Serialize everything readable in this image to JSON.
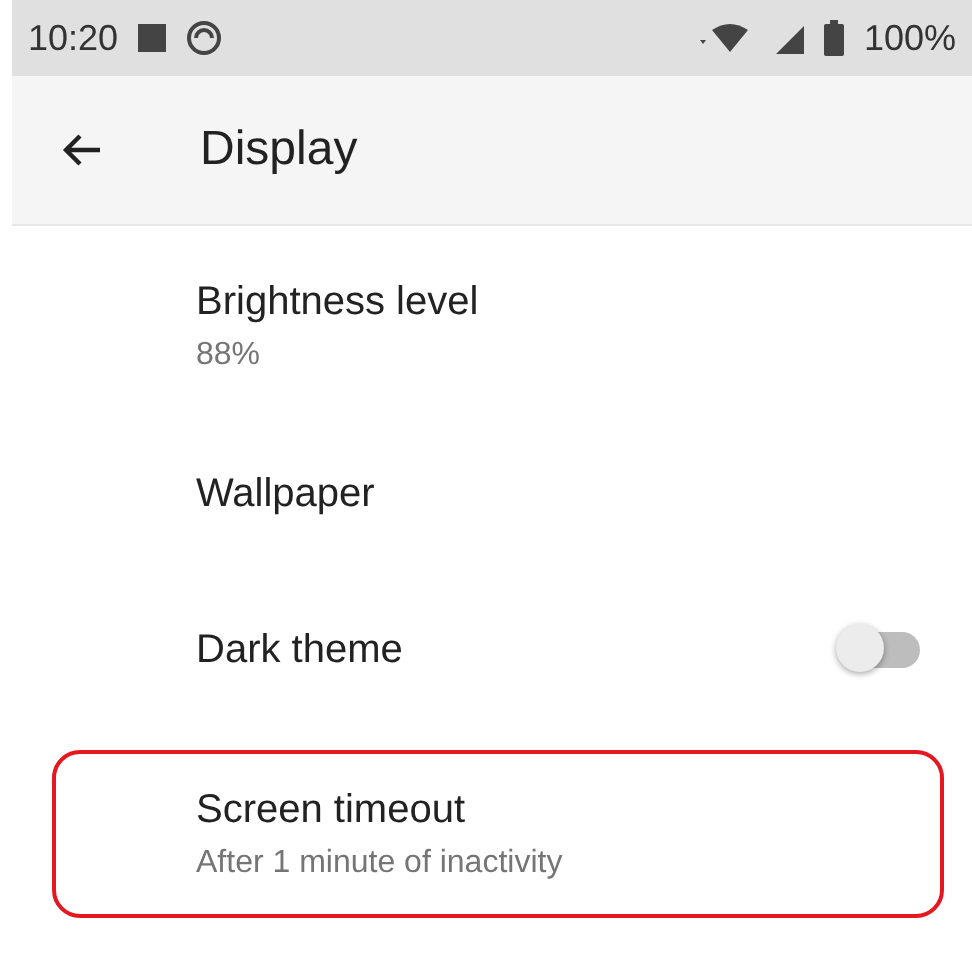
{
  "status_bar": {
    "time": "10:20",
    "battery": "100%"
  },
  "toolbar": {
    "title": "Display"
  },
  "settings": [
    {
      "kind": "text",
      "title": "Brightness level",
      "summary": "88%",
      "highlighted": false
    },
    {
      "kind": "text",
      "title": "Wallpaper",
      "highlighted": false
    },
    {
      "kind": "switch",
      "title": "Dark theme",
      "on": false,
      "highlighted": false
    },
    {
      "kind": "text",
      "title": "Screen timeout",
      "summary": "After 1 minute of inactivity",
      "highlighted": true
    }
  ]
}
